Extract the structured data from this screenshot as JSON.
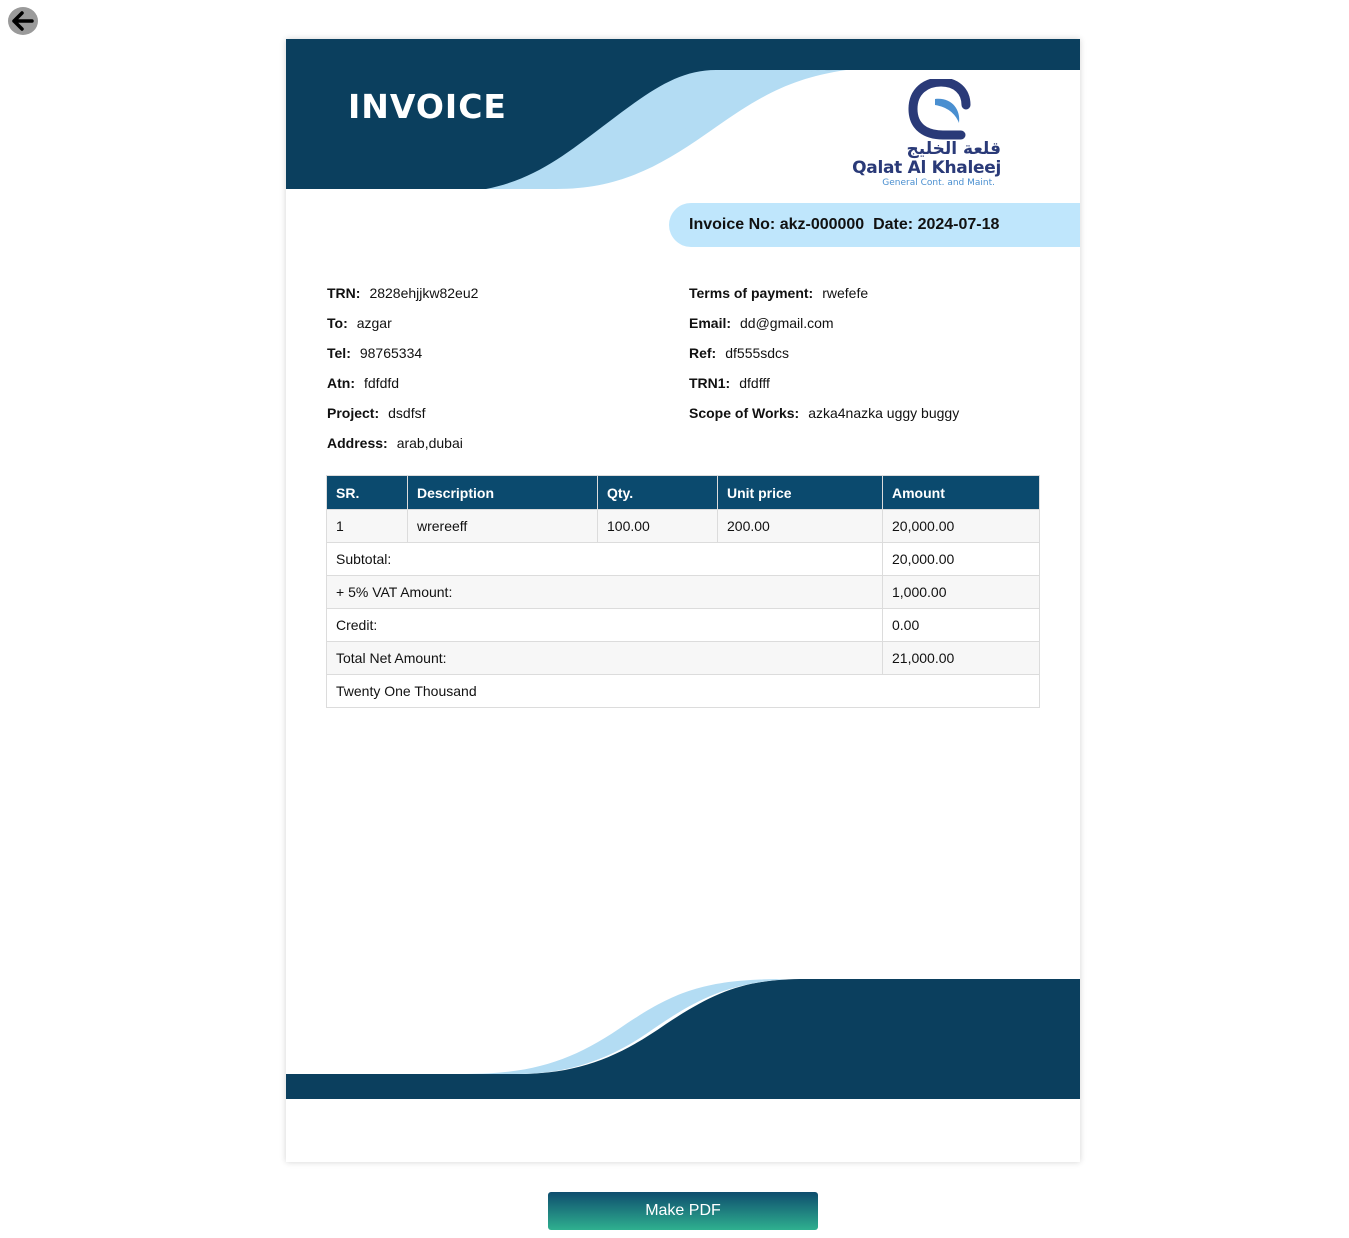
{
  "colors": {
    "navy": "#0b3f5e",
    "light_blue": "#b3dcf3",
    "pill": "#bfe6fc",
    "table_head": "#0b4a6e"
  },
  "icons": {
    "back": "arrow-left-icon"
  },
  "header": {
    "title": "INVOICE"
  },
  "logo": {
    "arabic": "قلعة الخليج",
    "name": "Qalat Al Khaleej",
    "subtitle": "General Cont. and Maint."
  },
  "invoice": {
    "number_label": "Invoice No:",
    "number": "akz-000000",
    "date_label": "Date:",
    "date": "2024-07-18"
  },
  "details_left": [
    {
      "label": "TRN:",
      "value": "2828ehjjkw82eu2"
    },
    {
      "label": "To:",
      "value": "azgar"
    },
    {
      "label": "Tel:",
      "value": "98765334"
    },
    {
      "label": "Atn:",
      "value": "fdfdfd"
    },
    {
      "label": "Project:",
      "value": "dsdfsf"
    },
    {
      "label": "Address:",
      "value": "arab,dubai"
    }
  ],
  "details_right": [
    {
      "label": "Terms of payment:",
      "value": "rwefefe"
    },
    {
      "label": "Email:",
      "value": "dd@gmail.com"
    },
    {
      "label": "Ref:",
      "value": "df555sdcs"
    },
    {
      "label": "TRN1:",
      "value": "dfdfff"
    },
    {
      "label": "Scope of Works:",
      "value": "azka4nazka uggy buggy"
    }
  ],
  "table": {
    "headers": [
      "SR.",
      "Description",
      "Qty.",
      "Unit price",
      "Amount"
    ],
    "rows": [
      [
        "1",
        "wrereeff",
        "100.00",
        "200.00",
        "20,000.00"
      ]
    ],
    "summary": [
      {
        "label": "Subtotal:",
        "value": "20,000.00"
      },
      {
        "label": "+ 5% VAT Amount:",
        "value": "1,000.00"
      },
      {
        "label": "Credit:",
        "value": "0.00"
      },
      {
        "label": "Total Net Amount:",
        "value": "21,000.00"
      }
    ],
    "amount_in_words": "Twenty One Thousand"
  },
  "actions": {
    "make_pdf": "Make PDF"
  }
}
